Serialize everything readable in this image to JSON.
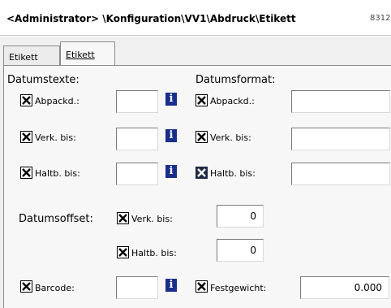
{
  "titlebar": {
    "path": "<Administrator> \\Konfiguration\\VV1\\Abdruck\\Etikett",
    "number": "8312"
  },
  "tabs": [
    {
      "label": "Etikett"
    },
    {
      "label": "Etikett"
    }
  ],
  "datumstexte": {
    "header": "Datumstexte:",
    "rows": [
      {
        "label": "Abpackd.:",
        "checked": true,
        "value": ""
      },
      {
        "label": "Verk. bis:",
        "checked": true,
        "value": ""
      },
      {
        "label": "Haltb. bis:",
        "checked": true,
        "value": ""
      }
    ]
  },
  "datumsformat": {
    "header": "Datumsformat:",
    "rows": [
      {
        "label": "Abpackd.:",
        "checked": true,
        "value": ""
      },
      {
        "label": "Verk. bis:",
        "checked": true,
        "value": ""
      },
      {
        "label": "Haltb. bis:",
        "checked": true,
        "value": ""
      }
    ]
  },
  "datumsoffset": {
    "label": "Datumsoffset:",
    "rows": [
      {
        "label": "Verk. bis:",
        "checked": true,
        "value": "0"
      },
      {
        "label": "Haltb. bis:",
        "checked": true,
        "value": "0"
      }
    ]
  },
  "barcode": {
    "label": "Barcode:",
    "checked": true,
    "value": ""
  },
  "festgewicht": {
    "label": "Festgewicht:",
    "checked": true,
    "value": "0.000"
  },
  "info_glyph": "i",
  "icons": {
    "info": "info-icon",
    "check": "checkbox-checked"
  },
  "colors": {
    "info_bg": "#1a2e8c",
    "panel_bg": "#f7f7f7"
  }
}
